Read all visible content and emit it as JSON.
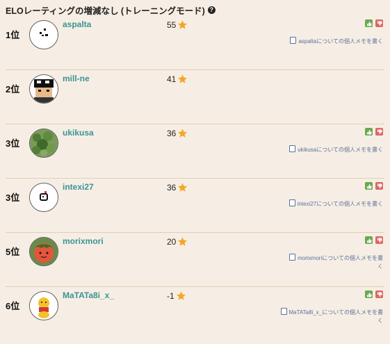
{
  "header": {
    "title": "ELOレーティングの増減なし (トレーニングモード)",
    "help_icon": "question-circle-icon"
  },
  "rows": [
    {
      "rank": "1位",
      "username": "aspalta",
      "score": "55",
      "show_votes": true,
      "memo": "aspaltaについての個人メモを書く"
    },
    {
      "rank": "2位",
      "username": "mill-ne",
      "score": "41",
      "show_votes": false,
      "memo": ""
    },
    {
      "rank": "3位",
      "username": "ukikusa",
      "score": "36",
      "show_votes": true,
      "memo": "ukikusaについての個人メモを書く"
    },
    {
      "rank": "3位",
      "username": "intexi27",
      "score": "36",
      "show_votes": true,
      "memo": "intexi27についての個人メモを書く"
    },
    {
      "rank": "5位",
      "username": "morixmori",
      "score": "20",
      "show_votes": true,
      "memo": "morixmoriについての個人メモを書く"
    },
    {
      "rank": "6位",
      "username": "MaTATa8i_x_",
      "score": "-1",
      "show_votes": true,
      "memo": "MaTATa8i_x_についての個人メモを書く"
    }
  ],
  "icons": {
    "star": "star-icon",
    "thumbs_up": "thumbs-up-icon",
    "thumbs_down": "thumbs-down-icon",
    "memo": "note-icon"
  },
  "colors": {
    "username": "#3a9494",
    "star": "#f5a623",
    "thumbs_up": "#6aa84f",
    "thumbs_down": "#e06666",
    "memo_link": "#5a6f9a",
    "background": "#f6eee4"
  }
}
